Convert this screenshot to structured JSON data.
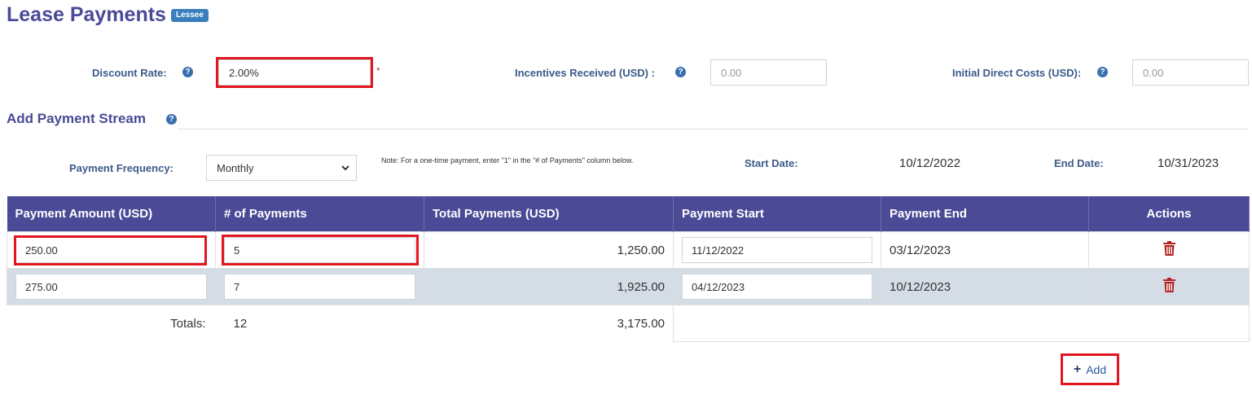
{
  "header": {
    "title": "Lease Payments",
    "badge": "Lessee"
  },
  "fields": {
    "discount_rate": {
      "label": "Discount Rate:",
      "value": "2.00%",
      "required": "*"
    },
    "incentives": {
      "label": "Incentives Received (USD) :",
      "placeholder": "0.00"
    },
    "initial_direct_costs": {
      "label": "Initial Direct Costs (USD):",
      "placeholder": "0.00"
    }
  },
  "payment_stream": {
    "title": "Add Payment Stream",
    "frequency_label": "Payment Frequency:",
    "frequency_value": "Monthly",
    "note": "Note: For a one-time payment, enter \"1\" in the \"# of Payments\" column below.",
    "start_label": "Start Date:",
    "start_value": "10/12/2022",
    "end_label": "End Date:",
    "end_value": "10/31/2023"
  },
  "table": {
    "columns": [
      "Payment Amount (USD)",
      "# of Payments",
      "Total Payments (USD)",
      "Payment Start",
      "Payment End",
      "Actions"
    ],
    "rows": [
      {
        "amount": "250.00",
        "count": "5",
        "total": "1,250.00",
        "start": "11/12/2022",
        "end": "03/12/2023"
      },
      {
        "amount": "275.00",
        "count": "7",
        "total": "1,925.00",
        "start": "04/12/2023",
        "end": "10/12/2023"
      }
    ],
    "totals": {
      "label": "Totals:",
      "count": "12",
      "total": "3,175.00"
    }
  },
  "actions": {
    "add_label": "Add"
  },
  "colors": {
    "header_bg": "#4a4a96",
    "highlight": "#e3151f",
    "trash": "#b22222"
  }
}
